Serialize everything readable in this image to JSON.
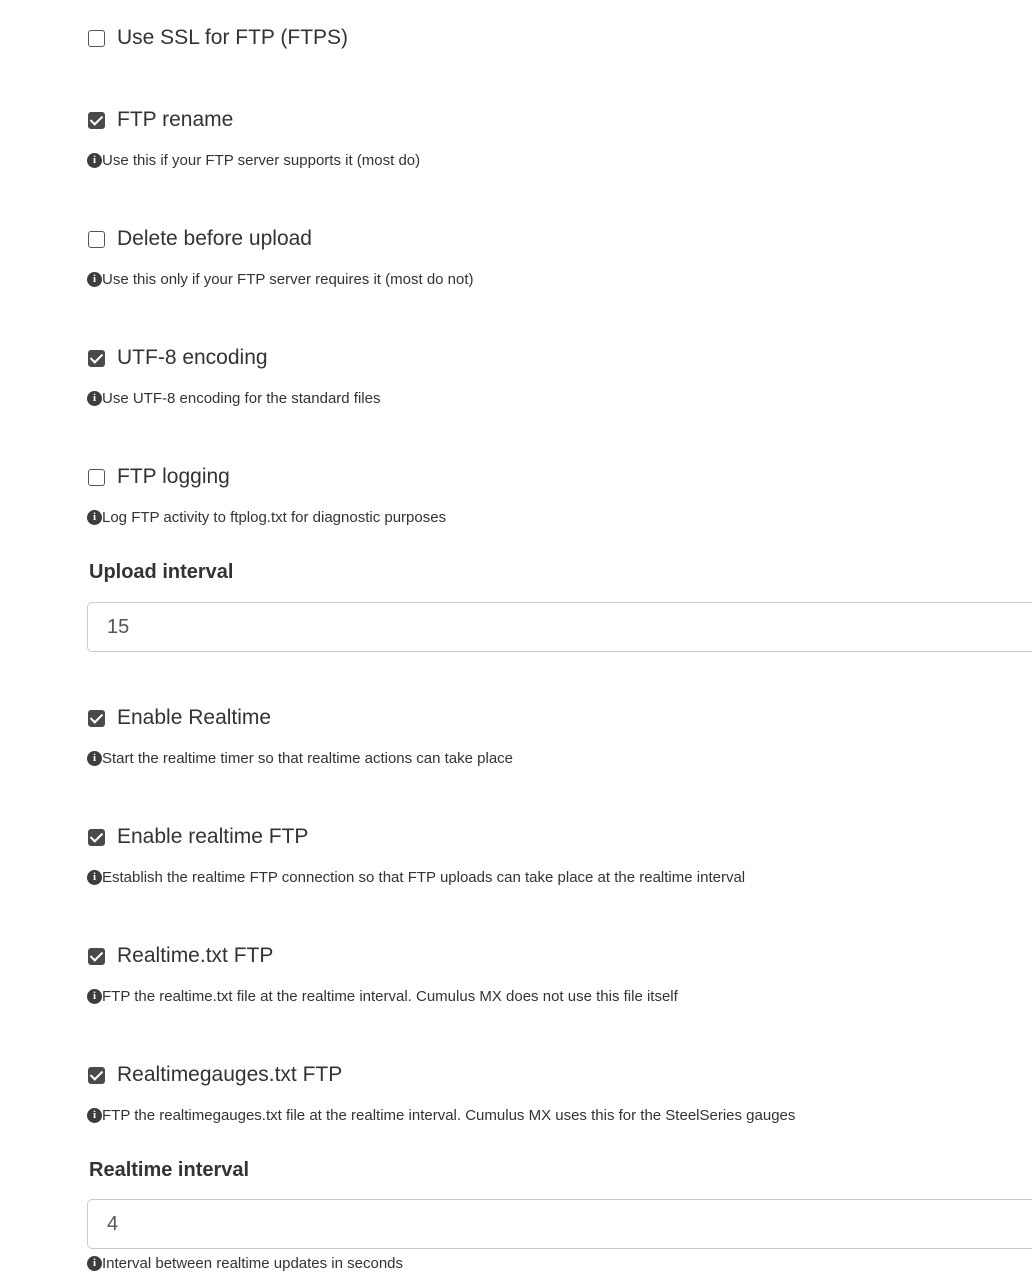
{
  "checkboxes": {
    "use_ssl": {
      "label": "Use SSL for FTP (FTPS)",
      "checked": false
    },
    "ftp_rename": {
      "label": "FTP rename",
      "checked": true,
      "help": "Use this if your FTP server supports it (most do)"
    },
    "delete_before_upload": {
      "label": "Delete before upload",
      "checked": false,
      "help": "Use this only if your FTP server requires it (most do not)"
    },
    "utf8_encoding": {
      "label": "UTF-8 encoding",
      "checked": true,
      "help": "Use UTF-8 encoding for the standard files"
    },
    "ftp_logging": {
      "label": "FTP logging",
      "checked": false,
      "help": "Log FTP activity to ftplog.txt for diagnostic purposes"
    },
    "enable_realtime": {
      "label": "Enable Realtime",
      "checked": true,
      "help": "Start the realtime timer so that realtime actions can take place"
    },
    "enable_realtime_ftp": {
      "label": "Enable realtime FTP",
      "checked": true,
      "help": "Establish the realtime FTP connection so that FTP uploads can take place at the realtime interval"
    },
    "realtime_txt_ftp": {
      "label": "Realtime.txt FTP",
      "checked": true,
      "help": "FTP the realtime.txt file at the realtime interval. Cumulus MX does not use this file itself"
    },
    "realtimegauges_txt_ftp": {
      "label": "Realtimegauges.txt FTP",
      "checked": true,
      "help": "FTP the realtimegauges.txt file at the realtime interval. Cumulus MX uses this for the SteelSeries gauges"
    }
  },
  "upload_interval": {
    "label": "Upload interval",
    "value": "15"
  },
  "realtime_interval": {
    "label": "Realtime interval",
    "value": "4",
    "help": "Interval between realtime updates in seconds"
  },
  "icons": {
    "info": "info-circle-icon",
    "info_glyph": "i"
  }
}
